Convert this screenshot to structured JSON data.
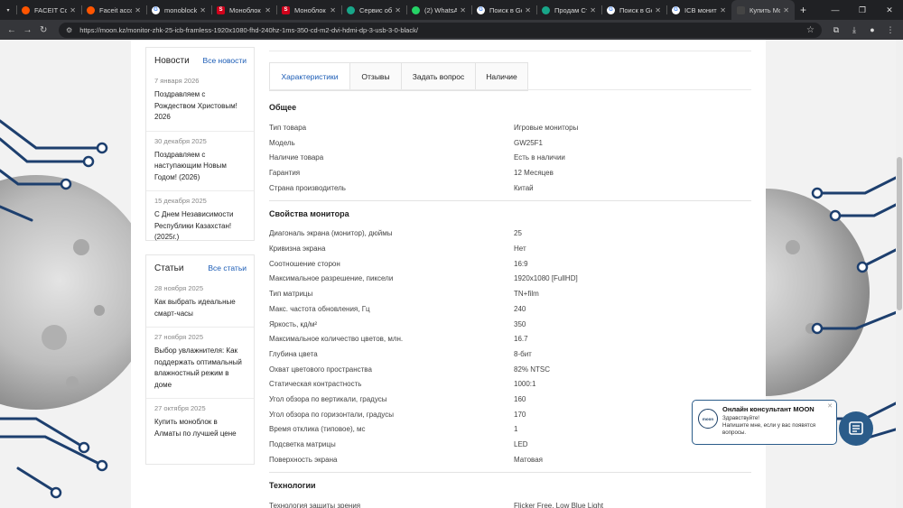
{
  "browser": {
    "tabs": [
      {
        "title": "",
        "favicon": "tab-list-icon",
        "color": "#202124"
      },
      {
        "title": "FACEIT Conv",
        "favicon": "faceit-icon",
        "color": "#ff5500"
      },
      {
        "title": "Faceit accou",
        "favicon": "faceit-icon",
        "color": "#ff5500"
      },
      {
        "title": "monoblock",
        "favicon": "google-icon",
        "color": "#ffffff"
      },
      {
        "title": "Моноблок",
        "favicon": "s-icon",
        "color": "#d0021b"
      },
      {
        "title": "Моноблок",
        "favicon": "s-icon",
        "color": "#d0021b"
      },
      {
        "title": "Сервис объ",
        "favicon": "chat-icon",
        "color": "#18a689"
      },
      {
        "title": "(2) WhatsAp",
        "favicon": "whatsapp-icon",
        "color": "#25d366"
      },
      {
        "title": "Поиск в Go",
        "favicon": "google-icon",
        "color": "#ffffff"
      },
      {
        "title": "Продам Ст",
        "favicon": "chat-icon",
        "color": "#18a689"
      },
      {
        "title": "Поиск в Go",
        "favicon": "google-icon",
        "color": "#ffffff"
      },
      {
        "title": "ICB монитор",
        "favicon": "google-icon",
        "color": "#ffffff"
      },
      {
        "title": "Купить Мо",
        "favicon": "moon-icon",
        "color": "#444444",
        "active": true
      }
    ],
    "url": "https://moon.kz/monitor-zhk-25-icb-framless-1920x1080-fhd-240hz-1ms-350-cd-m2-dvi-hdmi-dp-3-usb-3-0-black/"
  },
  "sidebar": {
    "news": {
      "title": "Новости",
      "all_link": "Все новости",
      "items": [
        {
          "date": "7 января 2026",
          "text": "Поздравляем с Рождеством Христовым! 2026"
        },
        {
          "date": "30 декабря 2025",
          "text": "Поздравляем с наступающим Новым Годом! (2026)"
        },
        {
          "date": "15 декабря 2025",
          "text": "С Днем Независимости Республики Казахстан! (2025г.)"
        }
      ]
    },
    "articles": {
      "title": "Статьи",
      "all_link": "Все статьи",
      "items": [
        {
          "date": "28 ноября 2025",
          "text": "Как выбрать идеальные смарт-часы"
        },
        {
          "date": "27 ноября 2025",
          "text": "Выбор увлажнителя: Как поддержать оптимальный влажностный режим в доме"
        },
        {
          "date": "27 октября 2025",
          "text": "Купить моноблок в Алматы по лучшей цене"
        }
      ]
    }
  },
  "product_tabs": [
    {
      "label": "Характеристики",
      "active": true
    },
    {
      "label": "Отзывы"
    },
    {
      "label": "Задать вопрос"
    },
    {
      "label": "Наличие"
    }
  ],
  "specs": [
    {
      "title": "Общее",
      "rows": [
        {
          "name": "Тип товара",
          "value": "Игровые мониторы"
        },
        {
          "name": "Модель",
          "value": "GW25F1"
        },
        {
          "name": "Наличие товара",
          "value": "Есть в наличии"
        },
        {
          "name": "Гарантия",
          "value": "12 Месяцев"
        },
        {
          "name": "Страна производитель",
          "value": "Китай"
        }
      ]
    },
    {
      "title": "Свойства монитора",
      "rows": [
        {
          "name": "Диагональ экрана (монитор), дюймы",
          "value": "25"
        },
        {
          "name": "Кривизна экрана",
          "value": "Нет"
        },
        {
          "name": "Соотношение сторон",
          "value": "16:9"
        },
        {
          "name": "Максимальное разрешение, пиксели",
          "value": "1920x1080 [FullHD]"
        },
        {
          "name": "Тип матрицы",
          "value": "TN+film"
        },
        {
          "name": "Макс. частота обновления, Гц",
          "value": "240"
        },
        {
          "name": "Яркость, кд/м²",
          "value": "350"
        },
        {
          "name": "Максимальное количество цветов, млн.",
          "value": "16.7"
        },
        {
          "name": "Глубина цвета",
          "value": "8-бит"
        },
        {
          "name": "Охват цветового пространства",
          "value": "82% NTSC"
        },
        {
          "name": "Статическая контрастность",
          "value": "1000:1"
        },
        {
          "name": "Угол обзора по вертикали, градусы",
          "value": "160"
        },
        {
          "name": "Угол обзора по горизонтали, градусы",
          "value": "170"
        },
        {
          "name": "Время отклика (типовое), мс",
          "value": "1"
        },
        {
          "name": "Подсветка матрицы",
          "value": "LED"
        },
        {
          "name": "Поверхность экрана",
          "value": "Матовая"
        }
      ]
    },
    {
      "title": "Технологии",
      "rows": [
        {
          "name": "Технология защиты зрения",
          "value": "Flicker Free, Low Blue Light"
        }
      ]
    }
  ],
  "chat": {
    "logo": "moon",
    "title": "Онлайн консультант MOON",
    "greeting": "Здравствуйте!",
    "text": "Напишите мне, если у вас появятся вопросы."
  },
  "colors": {
    "accent": "#1a5bb5",
    "chat": "#2b5c8a",
    "circuit": "#1d3f6e"
  }
}
